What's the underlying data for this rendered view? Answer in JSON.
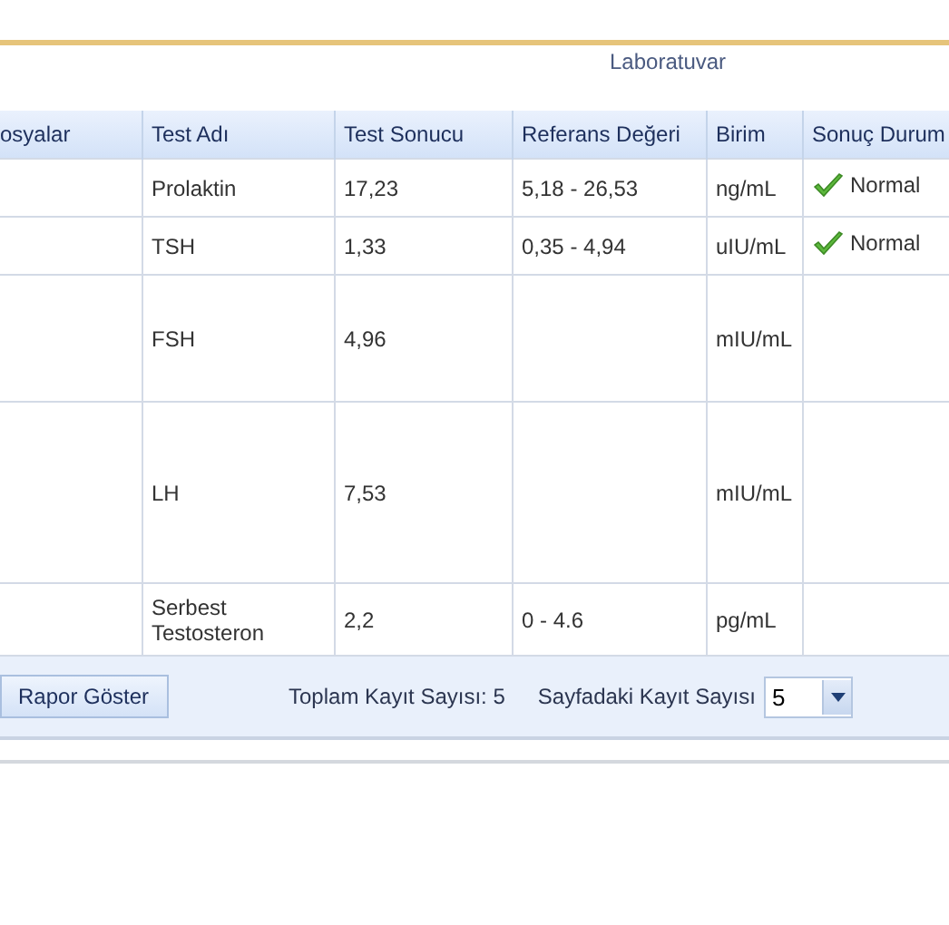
{
  "section_title": "Laboratuvar",
  "table": {
    "columns": [
      "osyalar",
      "Test Adı",
      "Test Sonucu",
      "Referans Değeri",
      "Birim",
      "Sonuç Durum"
    ],
    "rows": [
      {
        "test": "Prolaktin",
        "result": "17,23",
        "reference": "5,18 - 26,53",
        "unit": "ng/mL",
        "status": {
          "kind": "ok",
          "label": "Normal"
        }
      },
      {
        "test": "TSH",
        "result": "1,33",
        "reference": "0,35 - 4,94",
        "unit": "uIU/mL",
        "status": {
          "kind": "ok",
          "label": "Normal"
        }
      },
      {
        "test": "FSH",
        "result": "4,96",
        "unit": "mIU/mL"
      },
      {
        "test": "LH",
        "result": "7,53",
        "unit": "mIU/mL"
      },
      {
        "test": "Serbest Testosteron",
        "result": "2,2",
        "reference": "0 - 4.6",
        "unit": "pg/mL"
      }
    ]
  },
  "footer": {
    "report_button": "Rapor Göster",
    "total": "Toplam Kayıt Sayısı: 5",
    "page_size_label": "Sayfadaki Kayıt Sayısı",
    "page_size": "5"
  }
}
